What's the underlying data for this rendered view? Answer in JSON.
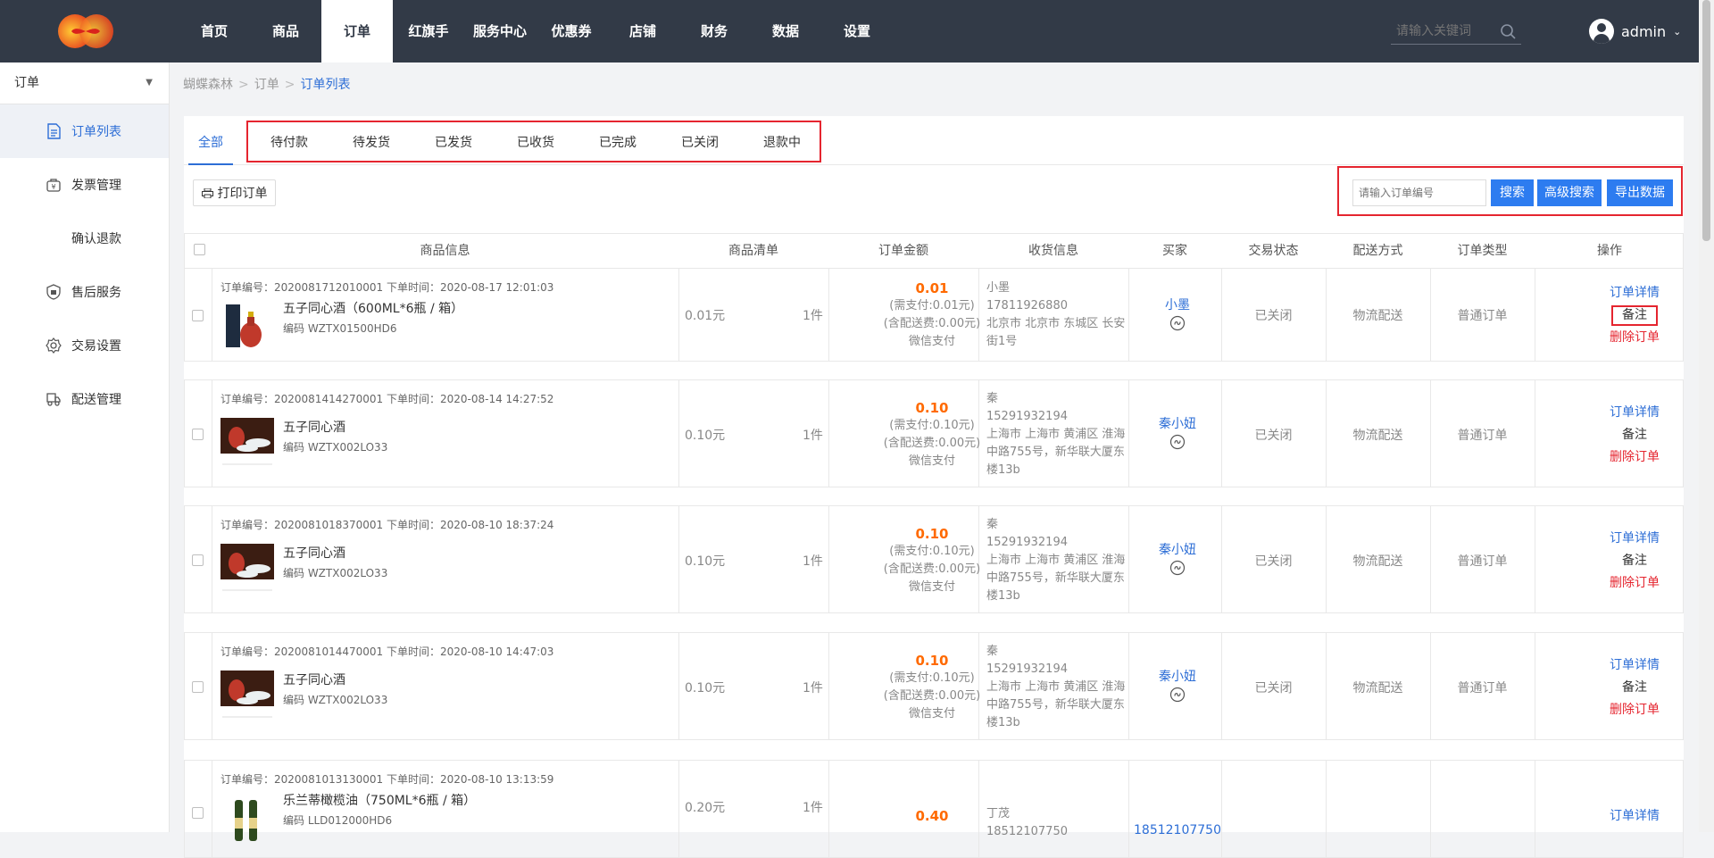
{
  "topbar": {
    "nav": [
      "首页",
      "商品",
      "订单",
      "红旗手",
      "服务中心",
      "优惠券",
      "店铺",
      "财务",
      "数据",
      "设置"
    ],
    "active_nav": 2,
    "search_placeholder": "请输入关键词",
    "user": "admin"
  },
  "sidebar": {
    "select": "订单",
    "items": [
      {
        "label": "订单列表",
        "icon": "document-icon",
        "active": true
      },
      {
        "label": "发票管理",
        "icon": "invoice-icon",
        "active": false
      },
      {
        "label": "确认退款",
        "icon": "",
        "active": false
      },
      {
        "label": "售后服务",
        "icon": "shield-icon",
        "active": false
      },
      {
        "label": "交易设置",
        "icon": "gear-icon",
        "active": false
      },
      {
        "label": "配送管理",
        "icon": "delivery-icon",
        "active": false
      }
    ]
  },
  "breadcrumb": [
    "蝴蝶森林",
    "订单",
    "订单列表"
  ],
  "tabs": [
    "全部",
    "待付款",
    "待发货",
    "已发货",
    "已收货",
    "已完成",
    "已关闭",
    "退款中"
  ],
  "toolbar": {
    "print": "打印订单",
    "order_search_placeholder": "请输入订单编号",
    "search": "搜索",
    "advanced": "高级搜索",
    "export": "导出数据"
  },
  "table_headers": [
    "商品信息",
    "商品清单",
    "订单金额",
    "收货信息",
    "买家",
    "交易状态",
    "配送方式",
    "订单类型",
    "操作"
  ],
  "orders": [
    {
      "meta": "订单编号：2020081712010001 下单时间：2020-08-17 12:01:03",
      "name": "五子同心酒（600ML*6瓶 / 箱）",
      "code": "编码  WZTX01500HD6",
      "price": "0.01元",
      "qty": "1件",
      "amount": "0.01",
      "need_pay": "(需支付:0.01元)",
      "shipping": "(含配送费:0.00元)",
      "pay_method": "微信支付",
      "recv_name": "小墨",
      "recv_phone": "17811926880",
      "recv_addr": "北京市 北京市 东城区 长安街1号",
      "buyer": "小墨",
      "status": "已关闭",
      "delivery": "物流配送",
      "type": "普通订单",
      "ops": [
        "订单详情",
        "备注",
        "删除订单"
      ]
    },
    {
      "meta": "订单编号：2020081414270001 下单时间：2020-08-14 14:27:52",
      "name": "五子同心酒",
      "code": "编码  WZTX002LO33",
      "price": "0.10元",
      "qty": "1件",
      "amount": "0.10",
      "need_pay": "(需支付:0.10元)",
      "shipping": "(含配送费:0.00元)",
      "pay_method": "微信支付",
      "recv_name": "秦",
      "recv_phone": "15291932194",
      "recv_addr": "上海市 上海市 黄浦区 淮海中路755号，新华联大厦东楼13b",
      "buyer": "秦小妞",
      "status": "已关闭",
      "delivery": "物流配送",
      "type": "普通订单",
      "ops": [
        "订单详情",
        "备注",
        "删除订单"
      ]
    },
    {
      "meta": "订单编号：2020081018370001 下单时间：2020-08-10 18:37:24",
      "name": "五子同心酒",
      "code": "编码  WZTX002LO33",
      "price": "0.10元",
      "qty": "1件",
      "amount": "0.10",
      "need_pay": "(需支付:0.10元)",
      "shipping": "(含配送费:0.00元)",
      "pay_method": "微信支付",
      "recv_name": "秦",
      "recv_phone": "15291932194",
      "recv_addr": "上海市 上海市 黄浦区 淮海中路755号，新华联大厦东楼13b",
      "buyer": "秦小妞",
      "status": "已关闭",
      "delivery": "物流配送",
      "type": "普通订单",
      "ops": [
        "订单详情",
        "备注",
        "删除订单"
      ]
    },
    {
      "meta": "订单编号：2020081014470001 下单时间：2020-08-10 14:47:03",
      "name": "五子同心酒",
      "code": "编码  WZTX002LO33",
      "price": "0.10元",
      "qty": "1件",
      "amount": "0.10",
      "need_pay": "(需支付:0.10元)",
      "shipping": "(含配送费:0.00元)",
      "pay_method": "微信支付",
      "recv_name": "秦",
      "recv_phone": "15291932194",
      "recv_addr": "上海市 上海市 黄浦区 淮海中路755号，新华联大厦东楼13b",
      "buyer": "秦小妞",
      "status": "已关闭",
      "delivery": "物流配送",
      "type": "普通订单",
      "ops": [
        "订单详情",
        "备注",
        "删除订单"
      ]
    },
    {
      "meta": "订单编号：2020081013130001 下单时间：2020-08-10 13:13:59",
      "name": "乐兰蒂橄榄油（750ML*6瓶 / 箱）",
      "code": "编码  LLD012000HD6",
      "price": "0.20元",
      "qty": "1件",
      "amount": "0.40",
      "recv_name": "丁茂",
      "recv_phone": "18512107750",
      "buyer": "18512107750",
      "ops": [
        "订单详情"
      ]
    }
  ]
}
